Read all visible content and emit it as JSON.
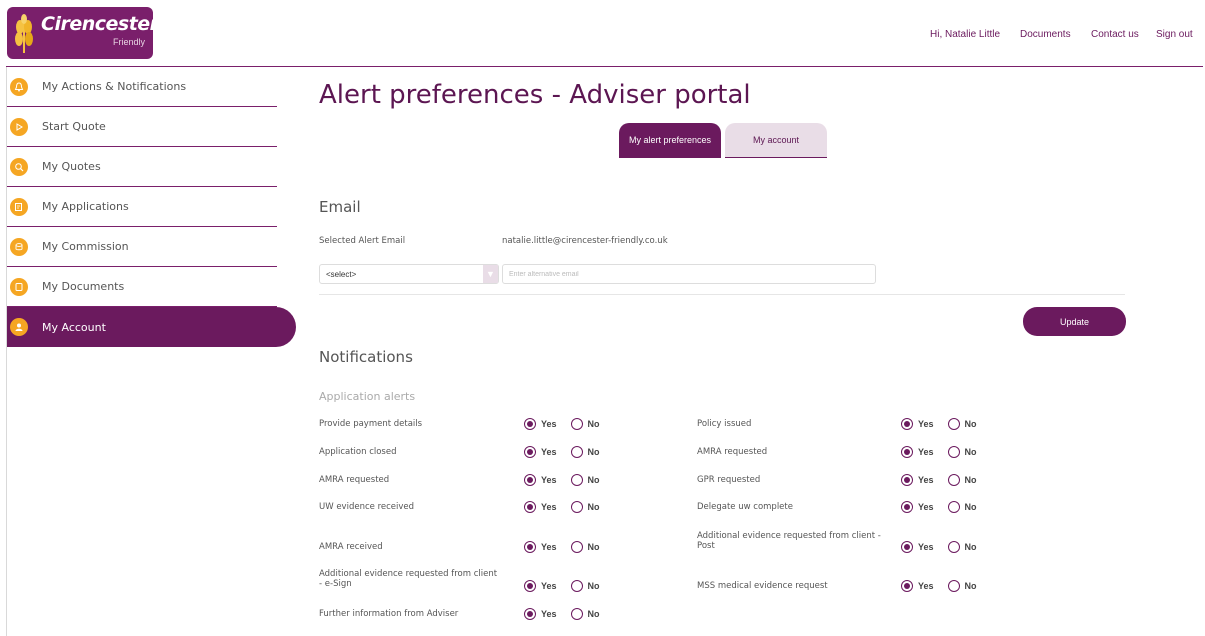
{
  "brand": {
    "name": "Cirencester",
    "sub": "Friendly",
    "color": "#7a1f6b"
  },
  "top_nav": {
    "greeting": "Hi, Natalie Little",
    "documents": "Documents",
    "contact": "Contact us",
    "signout": "Sign out"
  },
  "sidebar": {
    "items": [
      {
        "label": "My Actions & Notifications",
        "icon": "bell-icon"
      },
      {
        "label": "Start Quote",
        "icon": "play-icon"
      },
      {
        "label": "My Quotes",
        "icon": "search-icon"
      },
      {
        "label": "My Applications",
        "icon": "edit-icon"
      },
      {
        "label": "My Commission",
        "icon": "coins-icon"
      },
      {
        "label": "My Documents",
        "icon": "document-icon"
      },
      {
        "label": "My Account",
        "icon": "user-icon",
        "active": true
      }
    ]
  },
  "page": {
    "title": "Alert preferences - Adviser portal",
    "tabs": {
      "active": "My alert preferences",
      "inactive": "My account"
    }
  },
  "email": {
    "heading": "Email",
    "selected_label": "Selected Alert Email",
    "selected_value": "natalie.little@cirencester-friendly.co.uk",
    "select_value": "<select>",
    "alt_placeholder": "Enter alternative email",
    "update_label": "Update"
  },
  "notifications": {
    "heading": "Notifications",
    "subheading": "Application alerts",
    "yes": "Yes",
    "no": "No",
    "left": [
      "Provide payment details",
      "Application closed",
      "AMRA requested",
      "UW evidence received",
      "AMRA received",
      "Additional evidence requested from client - e-Sign",
      "Further information from Adviser"
    ],
    "right": [
      "Policy issued",
      "AMRA requested",
      "GPR requested",
      "Delegate uw complete",
      "Additional evidence requested from client - Post",
      "MSS medical evidence request"
    ]
  }
}
